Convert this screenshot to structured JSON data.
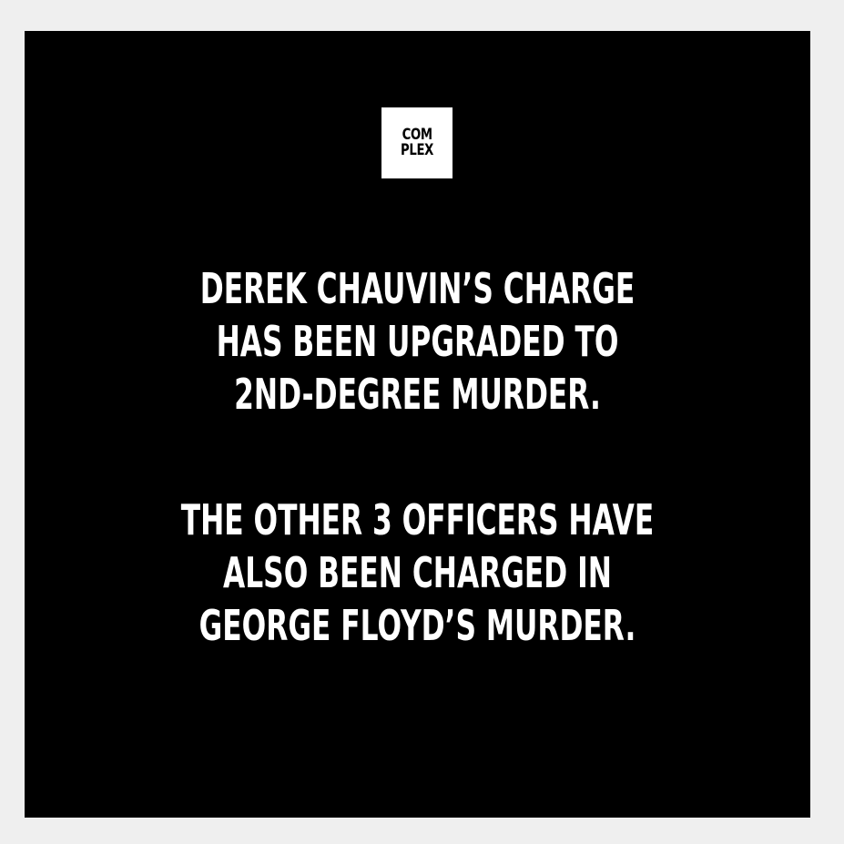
{
  "logo": {
    "line1": "COM",
    "line2": "PLEX"
  },
  "message": {
    "block1": [
      "DEREK CHAUVIN’S CHARGE",
      "HAS BEEN UPGRADED TO",
      "2ND-DEGREE MURDER."
    ],
    "block2": [
      "THE OTHER 3 OFFICERS HAVE",
      "ALSO BEEN CHARGED IN",
      "GEORGE FLOYD’S MURDER."
    ]
  },
  "colors": {
    "background": "#000000",
    "frame": "#efefef",
    "text": "#ffffff"
  }
}
